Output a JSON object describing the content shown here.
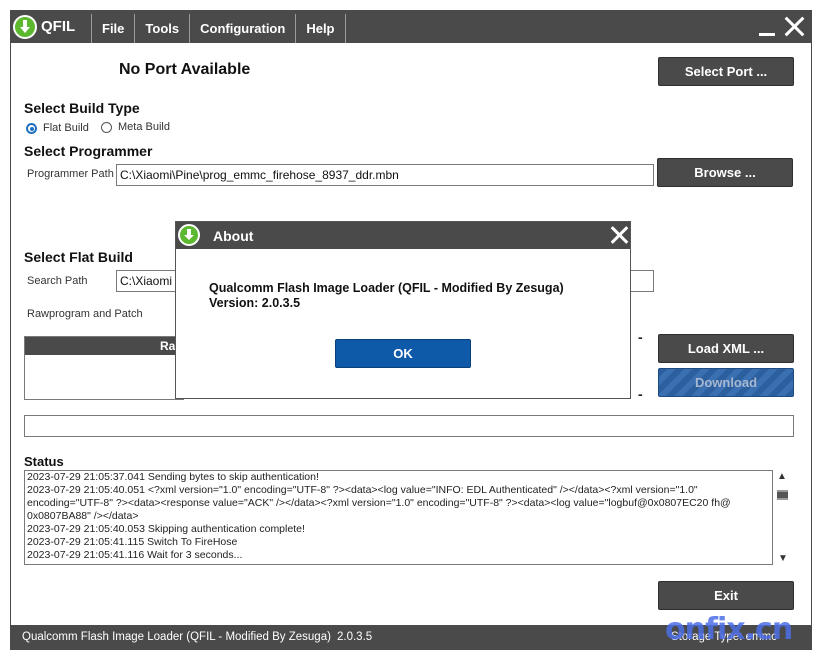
{
  "app": {
    "name": "QFIL",
    "menu": [
      "File",
      "Tools",
      "Configuration",
      "Help"
    ]
  },
  "port": {
    "status": "No Port Available",
    "select_button": "Select Port ..."
  },
  "build_type": {
    "heading": "Select Build Type",
    "options": [
      {
        "label": "Flat Build",
        "selected": true
      },
      {
        "label": "Meta Build",
        "selected": false
      }
    ]
  },
  "programmer": {
    "heading": "Select Programmer",
    "path_label": "Programmer Path",
    "path_value": "C:\\Xiaomi\\Pine\\prog_emmc_firehose_8937_ddr.mbn",
    "browse_button": "Browse ..."
  },
  "flat_build": {
    "heading": "Select Flat Build",
    "search_label": "Search Path",
    "search_value": "C:\\Xiaomi",
    "rawprogram_label": "Rawprogram and Patch",
    "table_header_partial": "Ra",
    "load_xml_button": "Load XML ...",
    "download_button": "Download",
    "dash": "-"
  },
  "status": {
    "heading": "Status",
    "log": [
      "2023-07-29 21:05:37.041     Sending bytes to skip authentication!",
      "2023-07-29 21:05:40.051     <?xml version=\"1.0\" encoding=\"UTF-8\" ?><data><log value=\"INFO: EDL Authenticated\" /></data><?xml version=\"1.0\"",
      "encoding=\"UTF-8\" ?><data><response value=\"ACK\" /></data><?xml version=\"1.0\" encoding=\"UTF-8\" ?><data><log value=\"logbuf@0x0807EC20 fh@",
      "0x0807BA88\" /></data>",
      "2023-07-29 21:05:40.053     Skipping authentication complete!",
      "2023-07-29 21:05:41.115     Switch To FireHose",
      "2023-07-29 21:05:41.116     Wait for 3 seconds..."
    ],
    "exit_button": "Exit"
  },
  "statusbar": {
    "title": "Qualcomm Flash Image Loader (QFIL - Modified By Zesuga)",
    "version": "2.0.3.5",
    "storage_partial": "Storage Type:  emmc"
  },
  "about_dialog": {
    "title": "About",
    "line1": "Qualcomm Flash Image Loader (QFIL - Modified By Zesuga)",
    "line2": "Version: 2.0.3.5",
    "ok_button": "OK"
  },
  "watermark": "onfix.cn",
  "colors": {
    "chrome": "#4a4a4a",
    "ok_blue": "#0f5aa8",
    "download_blue": "#2c5f9e",
    "logo_green": "#5cb82e",
    "watermark": "#4d6fe8"
  }
}
